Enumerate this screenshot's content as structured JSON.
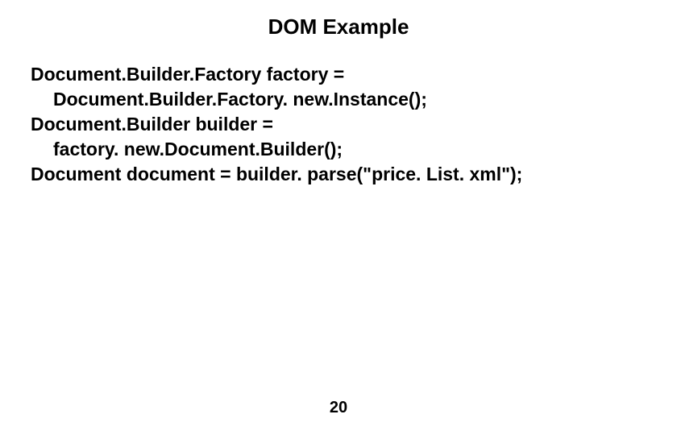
{
  "title": "DOM Example",
  "code": {
    "line1": "Document.Builder.Factory factory =",
    "line2": "Document.Builder.Factory. new.Instance();",
    "line3": "Document.Builder builder =",
    "line4": "factory. new.Document.Builder();",
    "line5": "Document document = builder. parse(\"price. List. xml\");"
  },
  "page_number": "20"
}
